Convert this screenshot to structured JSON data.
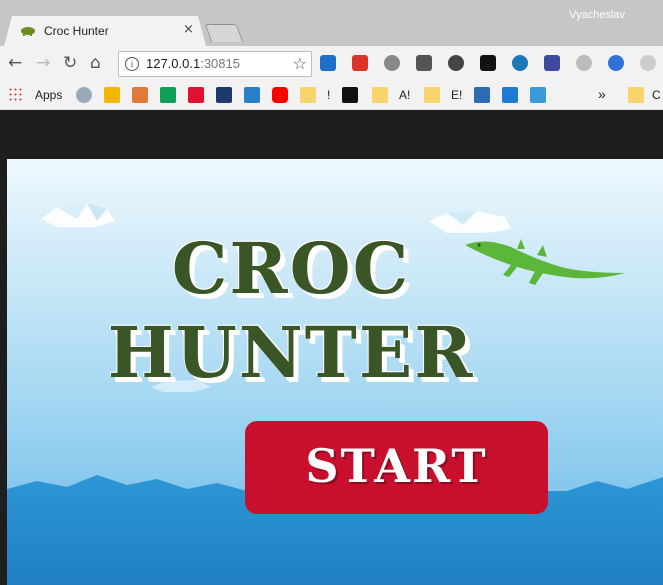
{
  "browser": {
    "tab": {
      "title": "Croc Hunter",
      "close": "×"
    },
    "user": "Vyacheslav",
    "omnibox": {
      "host": "127.0.0.1",
      "port": ":30815"
    },
    "icons": {
      "back": "back-arrow-icon",
      "forward": "forward-arrow-icon",
      "reload": "reload-icon",
      "home": "home-icon",
      "info": "info-icon",
      "star": "bookmark-star-icon"
    }
  },
  "bookmarks": {
    "apps": "Apps",
    "items": [
      "!",
      "A!",
      "E!"
    ],
    "more": "»",
    "overflow": "C"
  },
  "game": {
    "logo_line1": "CROC",
    "logo_line2": "HUNTER",
    "start_label": "START",
    "colors": {
      "sky_top": "#e8f6fc",
      "sky_bottom": "#5bb4e8",
      "water": "#2a8fd0",
      "logo": "#3b5626",
      "croc": "#5bb63a",
      "button": "#c8102e"
    }
  }
}
